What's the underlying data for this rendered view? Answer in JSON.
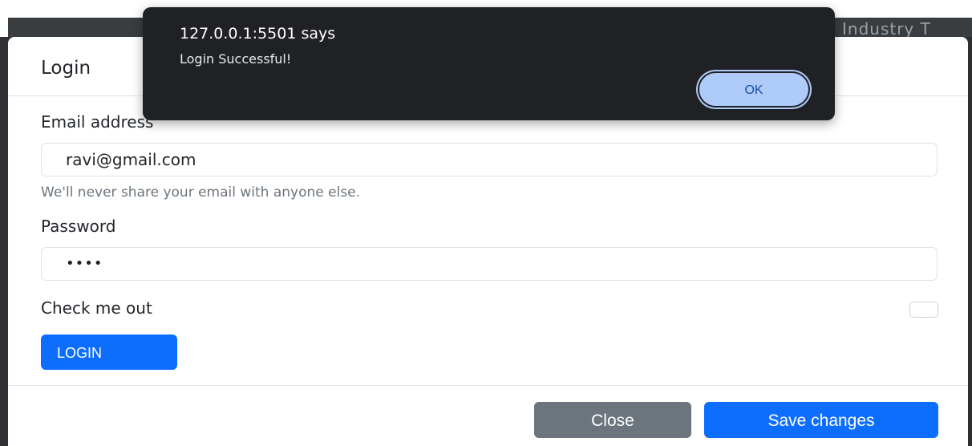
{
  "background": {
    "nav_text": "Industry T"
  },
  "modal": {
    "title": "Login",
    "email": {
      "label": "Email address",
      "value": "ravi@gmail.com",
      "help": "We'll never share your email with anyone else."
    },
    "password": {
      "label": "Password",
      "value": "••••"
    },
    "checkbox": {
      "label": "Check me out",
      "checked": false
    },
    "login_button": "LOGIN",
    "footer": {
      "close_label": "Close",
      "save_label": "Save changes"
    }
  },
  "alert": {
    "title": "127.0.0.1:5501 says",
    "message": "Login Successful!",
    "ok_label": "OK"
  },
  "colors": {
    "primary": "#0d6efd",
    "secondary": "#6c757d",
    "alert_bg": "#202124",
    "ok_button": "#aecbfa"
  }
}
